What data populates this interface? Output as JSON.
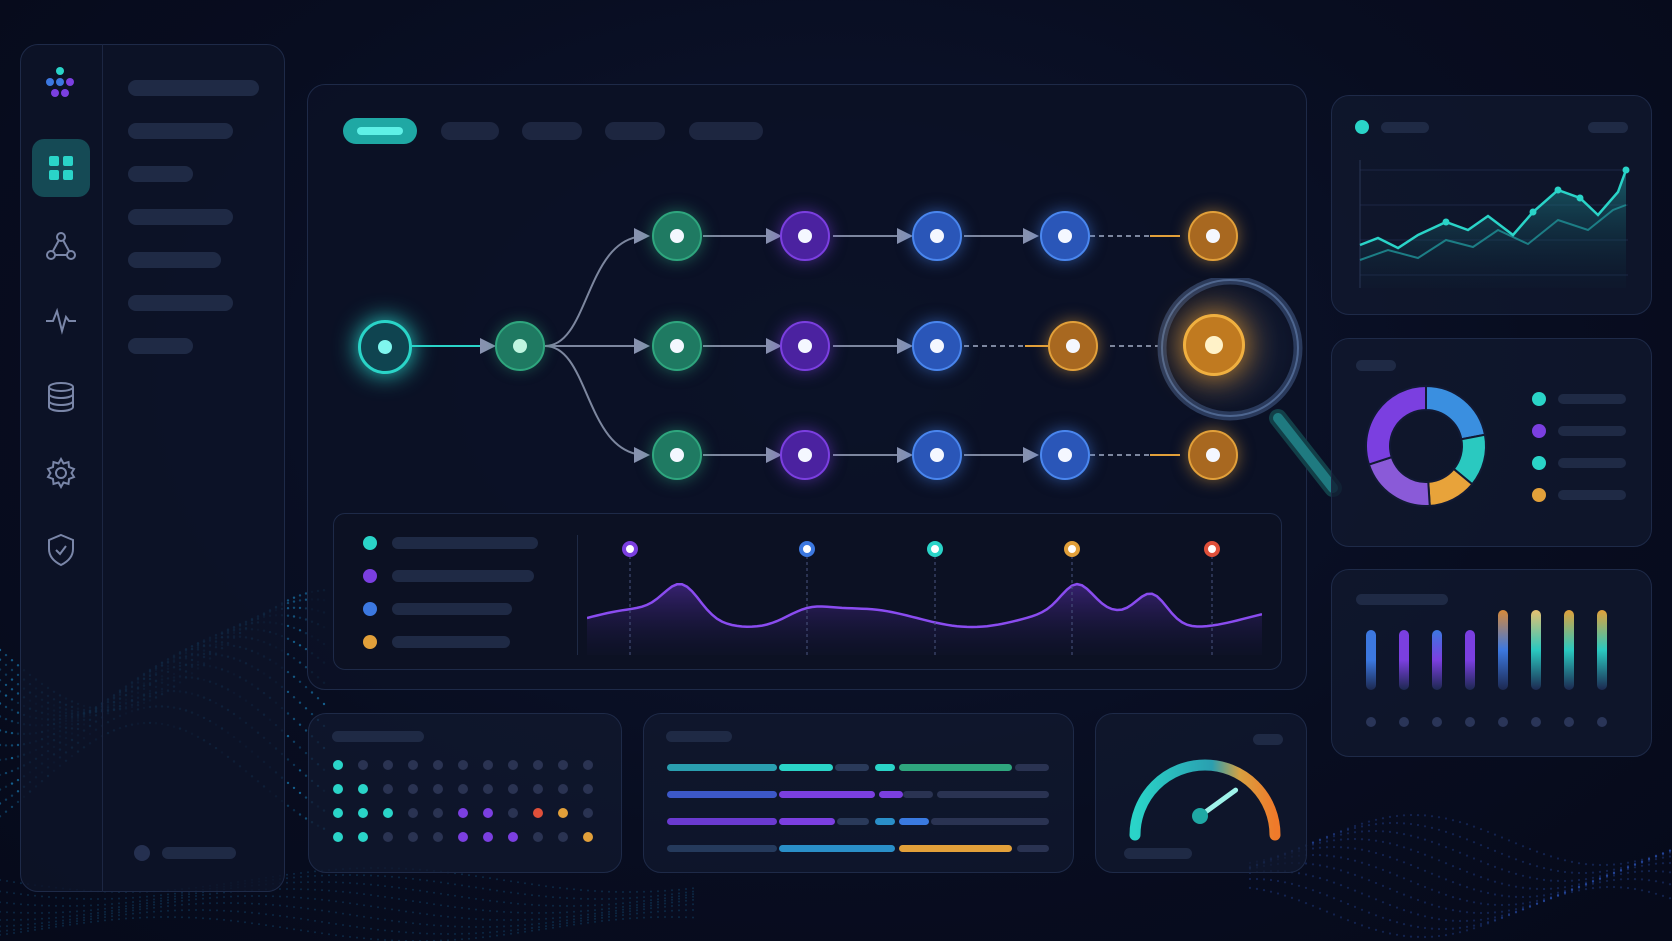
{
  "colors": {
    "teal": "#2ad4c8",
    "green": "#2fa67e",
    "purple": "#7b3fe0",
    "blue": "#3c78e0",
    "orange": "#e2a03a",
    "red": "#e0503a",
    "dim": "#2a3352"
  },
  "sidebar": {
    "logo_icon": "logo-icon",
    "items": [
      {
        "icon": "grid-icon",
        "active": true
      },
      {
        "icon": "network-icon",
        "active": false
      },
      {
        "icon": "pulse-icon",
        "active": false
      },
      {
        "icon": "database-icon",
        "active": false
      },
      {
        "icon": "gear-icon",
        "active": false
      },
      {
        "icon": "shield-icon",
        "active": false
      }
    ]
  },
  "main": {
    "tabs_count": 5,
    "active_tab": 0,
    "flow_rows": [
      [
        "green",
        "purple",
        "blue",
        "blue",
        "orange"
      ],
      [
        "green",
        "purple",
        "blue",
        "orange",
        "orange"
      ],
      [
        "green",
        "purple",
        "blue",
        "blue",
        "orange"
      ]
    ],
    "timeline_legend": [
      "teal",
      "purple",
      "blue",
      "orange"
    ],
    "timeline_markers": [
      "purple",
      "blue",
      "teal",
      "orange",
      "red"
    ]
  },
  "donut": {
    "segments": [
      {
        "color": "#3a8fe0",
        "value": 0.22
      },
      {
        "color": "#2ac9c0",
        "value": 0.14
      },
      {
        "color": "#e8a33a",
        "value": 0.13
      },
      {
        "color": "#8a5ad8",
        "value": 0.21
      },
      {
        "color": "#7b3fe0",
        "value": 0.3
      }
    ],
    "legend": [
      "teal",
      "purple",
      "teal",
      "orange"
    ]
  },
  "gauge": {
    "value": 0.78
  }
}
